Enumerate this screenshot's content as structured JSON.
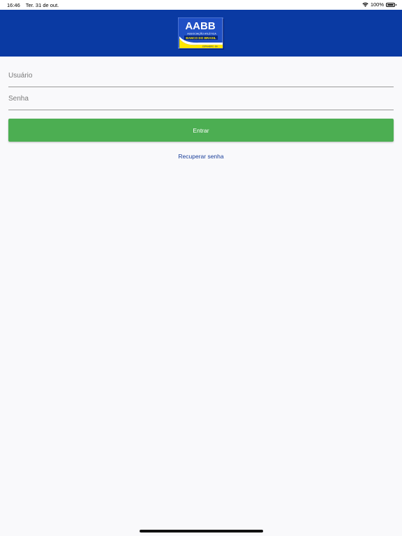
{
  "status_bar": {
    "time": "16:46",
    "date": "Ter. 31 de out.",
    "battery_percent": "100%",
    "battery_level": 1.0,
    "wifi_icon": "wifi-icon",
    "battery_icon": "battery-icon"
  },
  "header": {
    "background_color": "#0a3aa3",
    "logo": {
      "title": "AABB",
      "subtitle": "ASSOCIAÇÃO ATLÉTICA",
      "brand": "BANCO DO BRASIL",
      "location": "ESPINHEIRO - BA"
    }
  },
  "login": {
    "username_placeholder": "Usuário",
    "password_placeholder": "Senha",
    "submit_label": "Entrar",
    "submit_color": "#4cae52",
    "recover_label": "Recuperar senha"
  }
}
